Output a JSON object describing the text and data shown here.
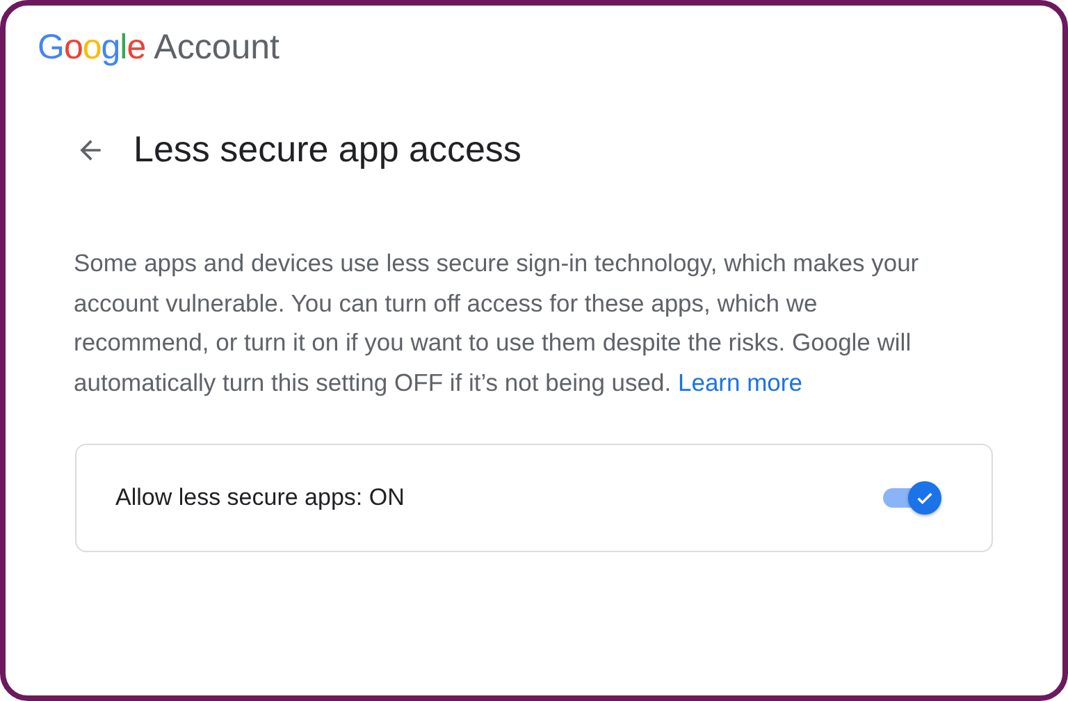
{
  "header": {
    "logo": "Google",
    "product": "Account"
  },
  "page": {
    "title": "Less secure app access"
  },
  "description": {
    "text": "Some apps and devices use less secure sign-in technology, which makes your account vulnerable. You can turn off access for these apps, which we recommend, or turn it on if you want to use them despite the risks. Google will automatically turn this setting OFF if it’s not being used.",
    "link": "Learn more"
  },
  "setting": {
    "label": "Allow less secure apps: ON",
    "on": true
  }
}
